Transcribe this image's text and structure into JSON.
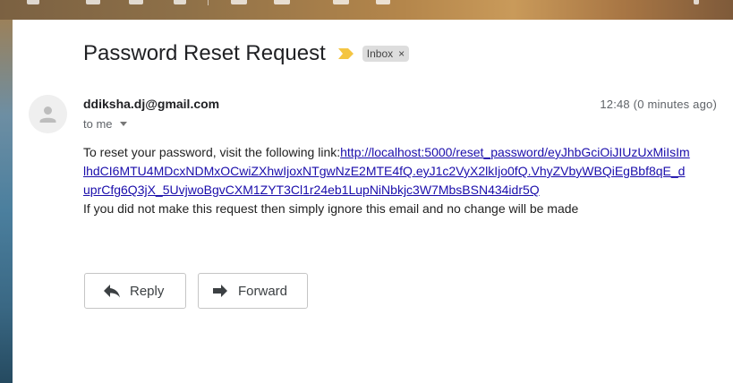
{
  "email": {
    "subject": "Password Reset Request",
    "label": "Inbox",
    "label_remove": "×",
    "sender": "ddiksha.dj@gmail.com",
    "recipient": "to me",
    "timestamp": "12:48 (0 minutes ago)",
    "body_intro": "To reset your password, visit the following link:",
    "body_link": "http://localhost:5000/reset_password/eyJhbGciOiJIUzUxMiIsImlhdCI6MTU4MDcxNDMxOCwiZXhwIjoxNTgwNzE2MTE4fQ.eyJ1c2VyX2lkIjo0fQ.VhyZVbyWBQiEgBbf8qE_duprCfg6Q3jX_5UvjwoBgvCXM1ZYT3Cl1r24eb1LupNiNbkjc3W7MbsBSN434idr5Q",
    "body_footer": "If you did not make this request then simply ignore this email and no change will be made"
  },
  "actions": {
    "reply_label": "Reply",
    "forward_label": "Forward"
  },
  "colors": {
    "importance_marker": "#f4c542",
    "link": "#1a0dab"
  },
  "icons": {
    "importance": "importance-marker-icon",
    "avatar": "person-avatar-icon",
    "reply": "reply-arrow-icon",
    "forward": "forward-arrow-icon",
    "remove_label": "close-icon",
    "details": "chevron-down-icon"
  }
}
